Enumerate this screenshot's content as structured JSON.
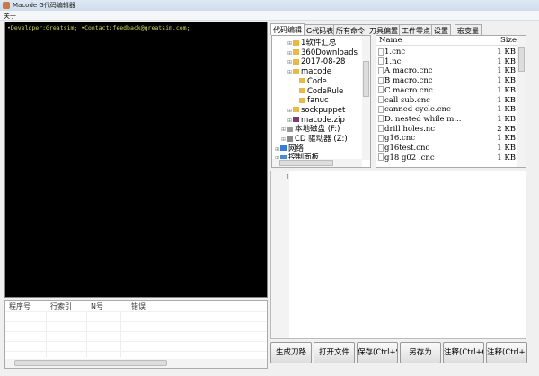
{
  "window": {
    "title": "Macode G代码编辑器"
  },
  "menu": {
    "about": "关于"
  },
  "console": {
    "text": "•Developer:Greatsim; •Contact:feedback@greatsim.com;"
  },
  "error_table": {
    "headers": [
      "程序号",
      "行索引",
      "N号",
      "错误"
    ]
  },
  "tabs": [
    "代码编辑",
    "G代码表",
    "所有命令",
    "刀具偏置",
    "工件零点",
    "设置",
    "宏变量"
  ],
  "tree": [
    {
      "label": "1软件汇总",
      "type": "folder",
      "indent": 3
    },
    {
      "label": "360Downloads",
      "type": "folder",
      "indent": 3
    },
    {
      "label": "2017-08-28",
      "type": "folder",
      "indent": 3
    },
    {
      "label": "macode",
      "type": "folder",
      "indent": 3
    },
    {
      "label": "Code",
      "type": "folder",
      "indent": 4
    },
    {
      "label": "CodeRule",
      "type": "folder",
      "indent": 4
    },
    {
      "label": "fanuc",
      "type": "folder",
      "indent": 4
    },
    {
      "label": "sockpuppet",
      "type": "folder",
      "indent": 3
    },
    {
      "label": "macode.zip",
      "type": "zip",
      "indent": 3
    },
    {
      "label": "本地磁盘 (F:)",
      "type": "drive",
      "indent": 2
    },
    {
      "label": "CD 驱动器 (Z:)",
      "type": "cd",
      "indent": 2
    },
    {
      "label": "网络",
      "type": "network",
      "indent": 1
    },
    {
      "label": "控制面板",
      "type": "panel",
      "indent": 1
    }
  ],
  "files": {
    "headers": {
      "name": "Name",
      "size": "Size"
    },
    "rows": [
      {
        "name": "1.cnc",
        "size": "1 KB"
      },
      {
        "name": "1.nc",
        "size": "1 KB"
      },
      {
        "name": "A macro.cnc",
        "size": "1 KB"
      },
      {
        "name": "B macro.cnc",
        "size": "1 KB"
      },
      {
        "name": "C macro.cnc",
        "size": "1 KB"
      },
      {
        "name": "call sub.cnc",
        "size": "1 KB"
      },
      {
        "name": "canned cycle.cnc",
        "size": "1 KB"
      },
      {
        "name": "D. nested while m...",
        "size": "1 KB"
      },
      {
        "name": "drill holes.nc",
        "size": "2 KB"
      },
      {
        "name": "g16.cnc",
        "size": "1 KB"
      },
      {
        "name": "g16test.cnc",
        "size": "1 KB"
      },
      {
        "name": "g18 g02 .cnc",
        "size": "1 KB"
      }
    ]
  },
  "editor": {
    "line_number": "1"
  },
  "buttons": [
    "生成刀路",
    "打开文件",
    "保存(Ctrl+S",
    "另存为",
    "注释(Ctrl+Q",
    "注释(Ctrl+"
  ]
}
